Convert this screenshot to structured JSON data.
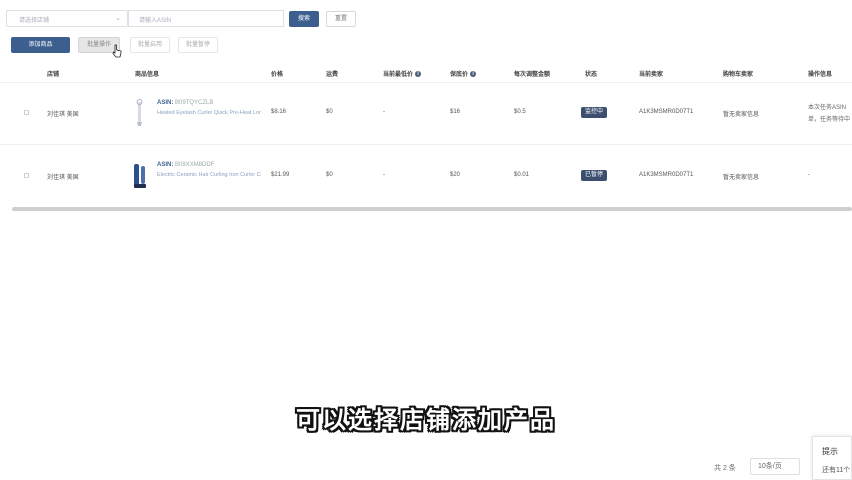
{
  "filters": {
    "store_select": "请选择店铺",
    "search_value": "请输入ASIN",
    "search_button": "搜索",
    "reset_button": "重置"
  },
  "toolbar": {
    "add_button": "添加商品",
    "batch_button": "批量操作",
    "button_3": "批量启用",
    "button_4": "批量暂停"
  },
  "table": {
    "headers": {
      "store": "店铺",
      "product": "商品信息",
      "price": "价格",
      "shipping": "运费",
      "current_min": "当前最低价",
      "guaranteed": "保底价",
      "step": "每次调整金额",
      "status": "状态",
      "seller": "当前卖家",
      "buybox": "购物车卖家",
      "ops": "操作信息"
    },
    "rows": [
      {
        "store": "刘佳琪 美国",
        "asin_label": "ASIN:",
        "asin": "B09TQYCZLB",
        "title": "Heated Eyelash Curler Quick Pre-Heat Long-Lasting Heated ...",
        "price": "$8.16",
        "shipping": "$0",
        "current_min": "-",
        "guaranteed": "$16",
        "step": "$0.5",
        "status": "监控中",
        "seller": "A1K3MSMR0D07T1",
        "buybox": "暂无卖家信息",
        "ops_line1": "本次任务ASIN",
        "ops_line2": "单，任务等待中"
      },
      {
        "store": "刘佳琪 美国",
        "asin_label": "ASIN:",
        "asin": "B09XXM8DDF",
        "title": "Electric Ceramic Hair Curling Iron Curler Cone Wand Hair ...",
        "price": "$21.99",
        "shipping": "$0",
        "current_min": "-",
        "guaranteed": "$20",
        "step": "$0.01",
        "status": "已暂停",
        "seller": "A1K3MSMR0D07T1",
        "buybox": "暂无卖家信息",
        "ops_line1": "-",
        "ops_line2": ""
      }
    ]
  },
  "subtitle": "可以选择店铺添加产品",
  "pagination": {
    "total": "共 2 条",
    "page_size": "10条/页"
  },
  "toast": {
    "title": "提示",
    "body": "还有11个"
  },
  "colors": {
    "primary": "#3d5f8f",
    "status_tag": "#3d4f6f"
  }
}
